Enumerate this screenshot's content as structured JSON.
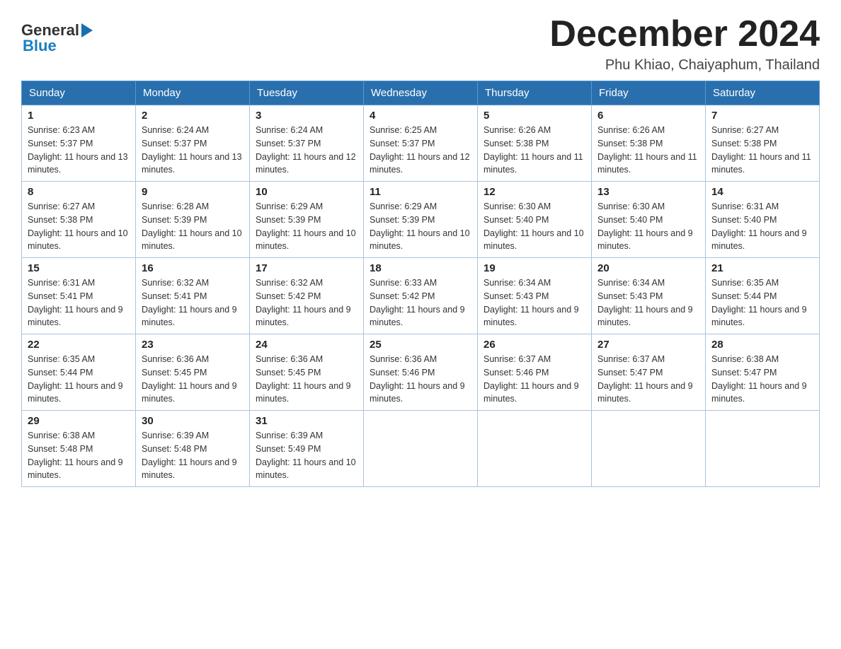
{
  "header": {
    "logo": {
      "text_general": "General",
      "text_blue": "Blue"
    },
    "title": "December 2024",
    "location": "Phu Khiao, Chaiyaphum, Thailand"
  },
  "weekdays": [
    "Sunday",
    "Monday",
    "Tuesday",
    "Wednesday",
    "Thursday",
    "Friday",
    "Saturday"
  ],
  "weeks": [
    [
      {
        "day": "1",
        "sunrise": "6:23 AM",
        "sunset": "5:37 PM",
        "daylight": "11 hours and 13 minutes."
      },
      {
        "day": "2",
        "sunrise": "6:24 AM",
        "sunset": "5:37 PM",
        "daylight": "11 hours and 13 minutes."
      },
      {
        "day": "3",
        "sunrise": "6:24 AM",
        "sunset": "5:37 PM",
        "daylight": "11 hours and 12 minutes."
      },
      {
        "day": "4",
        "sunrise": "6:25 AM",
        "sunset": "5:37 PM",
        "daylight": "11 hours and 12 minutes."
      },
      {
        "day": "5",
        "sunrise": "6:26 AM",
        "sunset": "5:38 PM",
        "daylight": "11 hours and 11 minutes."
      },
      {
        "day": "6",
        "sunrise": "6:26 AM",
        "sunset": "5:38 PM",
        "daylight": "11 hours and 11 minutes."
      },
      {
        "day": "7",
        "sunrise": "6:27 AM",
        "sunset": "5:38 PM",
        "daylight": "11 hours and 11 minutes."
      }
    ],
    [
      {
        "day": "8",
        "sunrise": "6:27 AM",
        "sunset": "5:38 PM",
        "daylight": "11 hours and 10 minutes."
      },
      {
        "day": "9",
        "sunrise": "6:28 AM",
        "sunset": "5:39 PM",
        "daylight": "11 hours and 10 minutes."
      },
      {
        "day": "10",
        "sunrise": "6:29 AM",
        "sunset": "5:39 PM",
        "daylight": "11 hours and 10 minutes."
      },
      {
        "day": "11",
        "sunrise": "6:29 AM",
        "sunset": "5:39 PM",
        "daylight": "11 hours and 10 minutes."
      },
      {
        "day": "12",
        "sunrise": "6:30 AM",
        "sunset": "5:40 PM",
        "daylight": "11 hours and 10 minutes."
      },
      {
        "day": "13",
        "sunrise": "6:30 AM",
        "sunset": "5:40 PM",
        "daylight": "11 hours and 9 minutes."
      },
      {
        "day": "14",
        "sunrise": "6:31 AM",
        "sunset": "5:40 PM",
        "daylight": "11 hours and 9 minutes."
      }
    ],
    [
      {
        "day": "15",
        "sunrise": "6:31 AM",
        "sunset": "5:41 PM",
        "daylight": "11 hours and 9 minutes."
      },
      {
        "day": "16",
        "sunrise": "6:32 AM",
        "sunset": "5:41 PM",
        "daylight": "11 hours and 9 minutes."
      },
      {
        "day": "17",
        "sunrise": "6:32 AM",
        "sunset": "5:42 PM",
        "daylight": "11 hours and 9 minutes."
      },
      {
        "day": "18",
        "sunrise": "6:33 AM",
        "sunset": "5:42 PM",
        "daylight": "11 hours and 9 minutes."
      },
      {
        "day": "19",
        "sunrise": "6:34 AM",
        "sunset": "5:43 PM",
        "daylight": "11 hours and 9 minutes."
      },
      {
        "day": "20",
        "sunrise": "6:34 AM",
        "sunset": "5:43 PM",
        "daylight": "11 hours and 9 minutes."
      },
      {
        "day": "21",
        "sunrise": "6:35 AM",
        "sunset": "5:44 PM",
        "daylight": "11 hours and 9 minutes."
      }
    ],
    [
      {
        "day": "22",
        "sunrise": "6:35 AM",
        "sunset": "5:44 PM",
        "daylight": "11 hours and 9 minutes."
      },
      {
        "day": "23",
        "sunrise": "6:36 AM",
        "sunset": "5:45 PM",
        "daylight": "11 hours and 9 minutes."
      },
      {
        "day": "24",
        "sunrise": "6:36 AM",
        "sunset": "5:45 PM",
        "daylight": "11 hours and 9 minutes."
      },
      {
        "day": "25",
        "sunrise": "6:36 AM",
        "sunset": "5:46 PM",
        "daylight": "11 hours and 9 minutes."
      },
      {
        "day": "26",
        "sunrise": "6:37 AM",
        "sunset": "5:46 PM",
        "daylight": "11 hours and 9 minutes."
      },
      {
        "day": "27",
        "sunrise": "6:37 AM",
        "sunset": "5:47 PM",
        "daylight": "11 hours and 9 minutes."
      },
      {
        "day": "28",
        "sunrise": "6:38 AM",
        "sunset": "5:47 PM",
        "daylight": "11 hours and 9 minutes."
      }
    ],
    [
      {
        "day": "29",
        "sunrise": "6:38 AM",
        "sunset": "5:48 PM",
        "daylight": "11 hours and 9 minutes."
      },
      {
        "day": "30",
        "sunrise": "6:39 AM",
        "sunset": "5:48 PM",
        "daylight": "11 hours and 9 minutes."
      },
      {
        "day": "31",
        "sunrise": "6:39 AM",
        "sunset": "5:49 PM",
        "daylight": "11 hours and 10 minutes."
      },
      null,
      null,
      null,
      null
    ]
  ],
  "labels": {
    "sunrise": "Sunrise:",
    "sunset": "Sunset:",
    "daylight": "Daylight:"
  }
}
